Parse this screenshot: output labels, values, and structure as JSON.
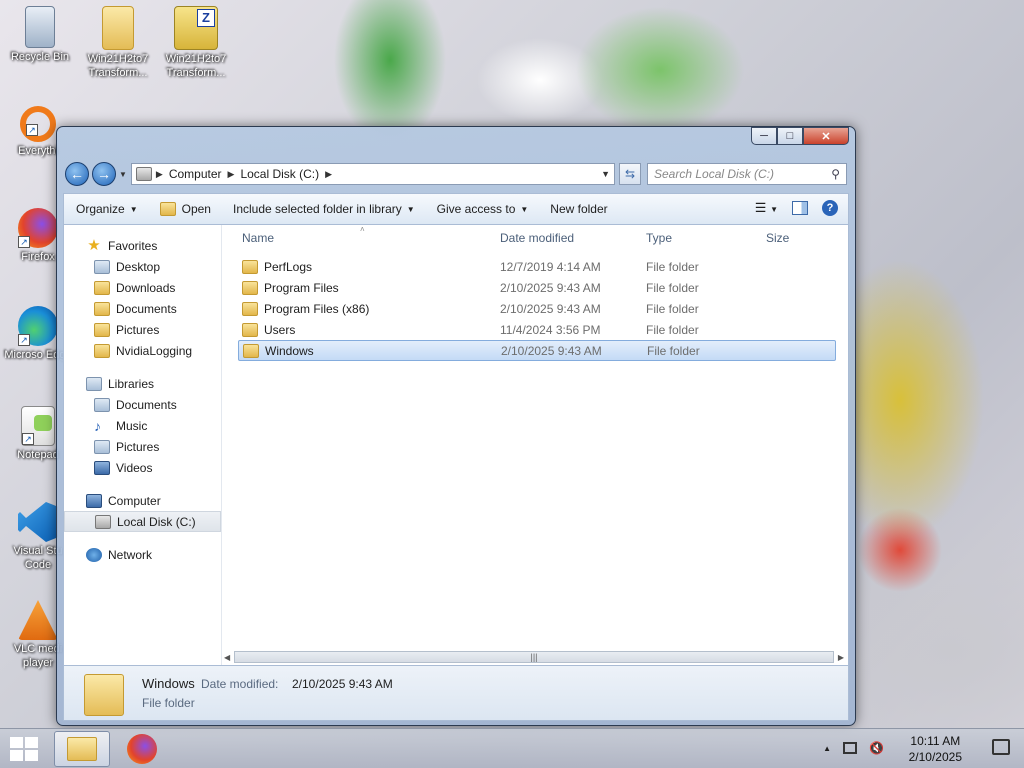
{
  "desktop": {
    "icons": [
      {
        "label": "Recycle Bin"
      },
      {
        "label": "Win21H2to7 Transform..."
      },
      {
        "label": "Win21H2to7 Transform..."
      },
      {
        "label": "Everythi"
      },
      {
        "label": "Firefox"
      },
      {
        "label": "Microso Edge"
      },
      {
        "label": "Notepad"
      },
      {
        "label": "Visual Stu Code"
      },
      {
        "label": "VLC medi player"
      }
    ]
  },
  "window": {
    "controls": {
      "minimize": "─",
      "maximize": "□",
      "close": "✕"
    },
    "address": {
      "crumbs": [
        "Computer",
        "Local Disk (C:)"
      ],
      "search_placeholder": "Search Local Disk (C:)"
    },
    "toolbar": {
      "organize": "Organize",
      "open": "Open",
      "include": "Include selected folder in library",
      "share": "Give access to",
      "new_folder": "New folder"
    },
    "nav": {
      "favorites": "Favorites",
      "fav_items": [
        "Desktop",
        "Downloads",
        "Documents",
        "Pictures",
        "NvidiaLogging"
      ],
      "libraries": "Libraries",
      "lib_items": [
        "Documents",
        "Music",
        "Pictures",
        "Videos"
      ],
      "computer": "Computer",
      "computer_items": [
        "Local Disk (C:)"
      ],
      "network": "Network"
    },
    "columns": {
      "name": "Name",
      "date": "Date modified",
      "type": "Type",
      "size": "Size"
    },
    "files": [
      {
        "name": "PerfLogs",
        "date": "12/7/2019 4:14 AM",
        "type": "File folder"
      },
      {
        "name": "Program Files",
        "date": "2/10/2025 9:43 AM",
        "type": "File folder"
      },
      {
        "name": "Program Files (x86)",
        "date": "2/10/2025 9:43 AM",
        "type": "File folder"
      },
      {
        "name": "Users",
        "date": "11/4/2024 3:56 PM",
        "type": "File folder"
      },
      {
        "name": "Windows",
        "date": "2/10/2025 9:43 AM",
        "type": "File folder",
        "selected": true
      }
    ],
    "details": {
      "name": "Windows",
      "date_label": "Date modified:",
      "date_value": "2/10/2025 9:43 AM",
      "type": "File folder"
    }
  },
  "taskbar": {
    "time": "10:11 AM",
    "date": "2/10/2025"
  }
}
